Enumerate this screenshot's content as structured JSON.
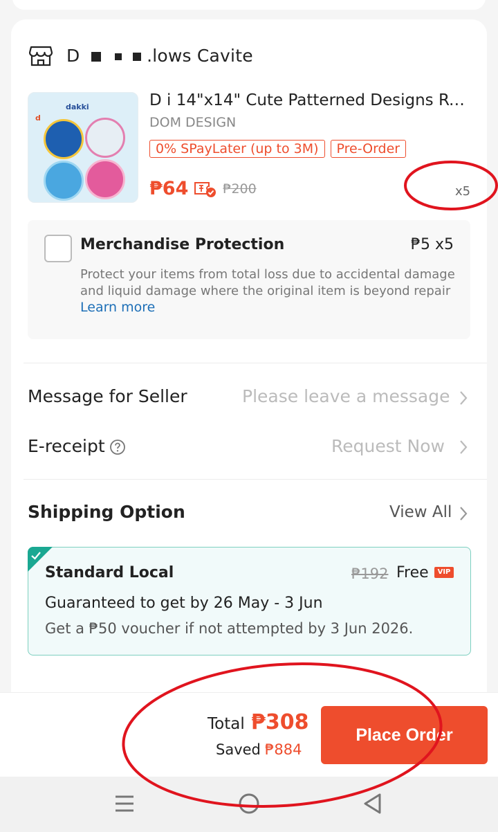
{
  "shop": {
    "name_prefix": "D",
    "name_suffix": ".lows Cavite",
    "icon": "shop-icon"
  },
  "product": {
    "thumb_brand": "dakki",
    "thumb_sub": "d",
    "title": "D     i 14\"x14\" Cute Patterned Designs Ro...",
    "variant": "DOM DESIGN",
    "tags": [
      "0% SPayLater (up to 3M)",
      "Pre-Order"
    ],
    "price": "₱64",
    "old_price": "₱200",
    "quantity": "x5"
  },
  "protection": {
    "title": "Merchandise Protection",
    "price": "₱5 x5",
    "description": "Protect your items from total loss due to accidental damage and liquid damage where the original item is beyond repair",
    "learn_more": "Learn more"
  },
  "message": {
    "label": "Message for Seller",
    "placeholder": "Please leave a message"
  },
  "ereceipt": {
    "label": "E-receipt",
    "action": "Request Now"
  },
  "shipping": {
    "title": "Shipping Option",
    "view_all": "View All",
    "option_name": "Standard Local",
    "old_fee": "₱192",
    "fee": "Free",
    "vip_badge": "VIP",
    "guarantee": "Guaranteed to get by 26 May - 3 Jun",
    "voucher_note": "Get a ₱50 voucher if not attempted by 3 Jun 2026."
  },
  "footer": {
    "total_label": "Total",
    "total_value": "₱308",
    "saved_label": "Saved",
    "saved_value": "₱884",
    "place_order": "Place Order"
  },
  "colors": {
    "accent": "#ee4d2d",
    "link": "#1d6fb7",
    "shipping_border": "#7dd0c0",
    "annotation": "#e0141e"
  }
}
